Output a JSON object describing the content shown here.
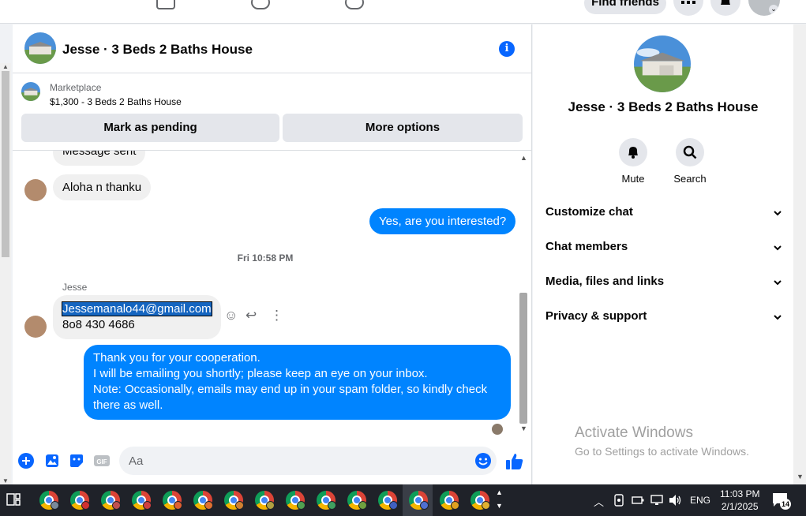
{
  "topnav": {
    "find_friends": "Find friends"
  },
  "chat": {
    "title": "Jesse · 3 Beds 2 Baths House",
    "marketplace": {
      "label": "Marketplace",
      "item": "$1,300 - 3 Beds 2 Baths House",
      "mark_pending": "Mark as pending",
      "more_options": "More options"
    },
    "messages": [
      {
        "text": "Message sent"
      },
      {
        "text": "Aloha n thanku"
      },
      {
        "text": "Yes, are you interested?"
      },
      {
        "timestamp": "Fri 10:58 PM"
      },
      {
        "sender": "Jesse"
      },
      {
        "line1": "Jessemanalo44@gmail.com",
        "line2": "8o8 430 4686"
      },
      {
        "lines": [
          "Thank you for your cooperation.",
          "I will be emailing you shortly; please keep an eye on your inbox.",
          "Note: Occasionally, emails may end up in your spam folder, so kindly check",
          "there as well."
        ]
      }
    ],
    "composer_placeholder": "Aa"
  },
  "panel": {
    "title": "Jesse · 3 Beds 2 Baths House",
    "mute": "Mute",
    "search": "Search",
    "sections": [
      "Customize chat",
      "Chat members",
      "Media, files and links",
      "Privacy & support"
    ]
  },
  "watermark": {
    "line1": "Activate Windows",
    "line2": "Go to Settings to activate Windows."
  },
  "taskbar": {
    "lang": "ENG",
    "time": "11:03 PM",
    "date": "2/1/2025",
    "notif_count": "14"
  },
  "colors": {
    "accent": "#0866ff",
    "bubble_out": "#0084ff",
    "bubble_in": "#f0f0f0",
    "selection": "#1565c0"
  }
}
